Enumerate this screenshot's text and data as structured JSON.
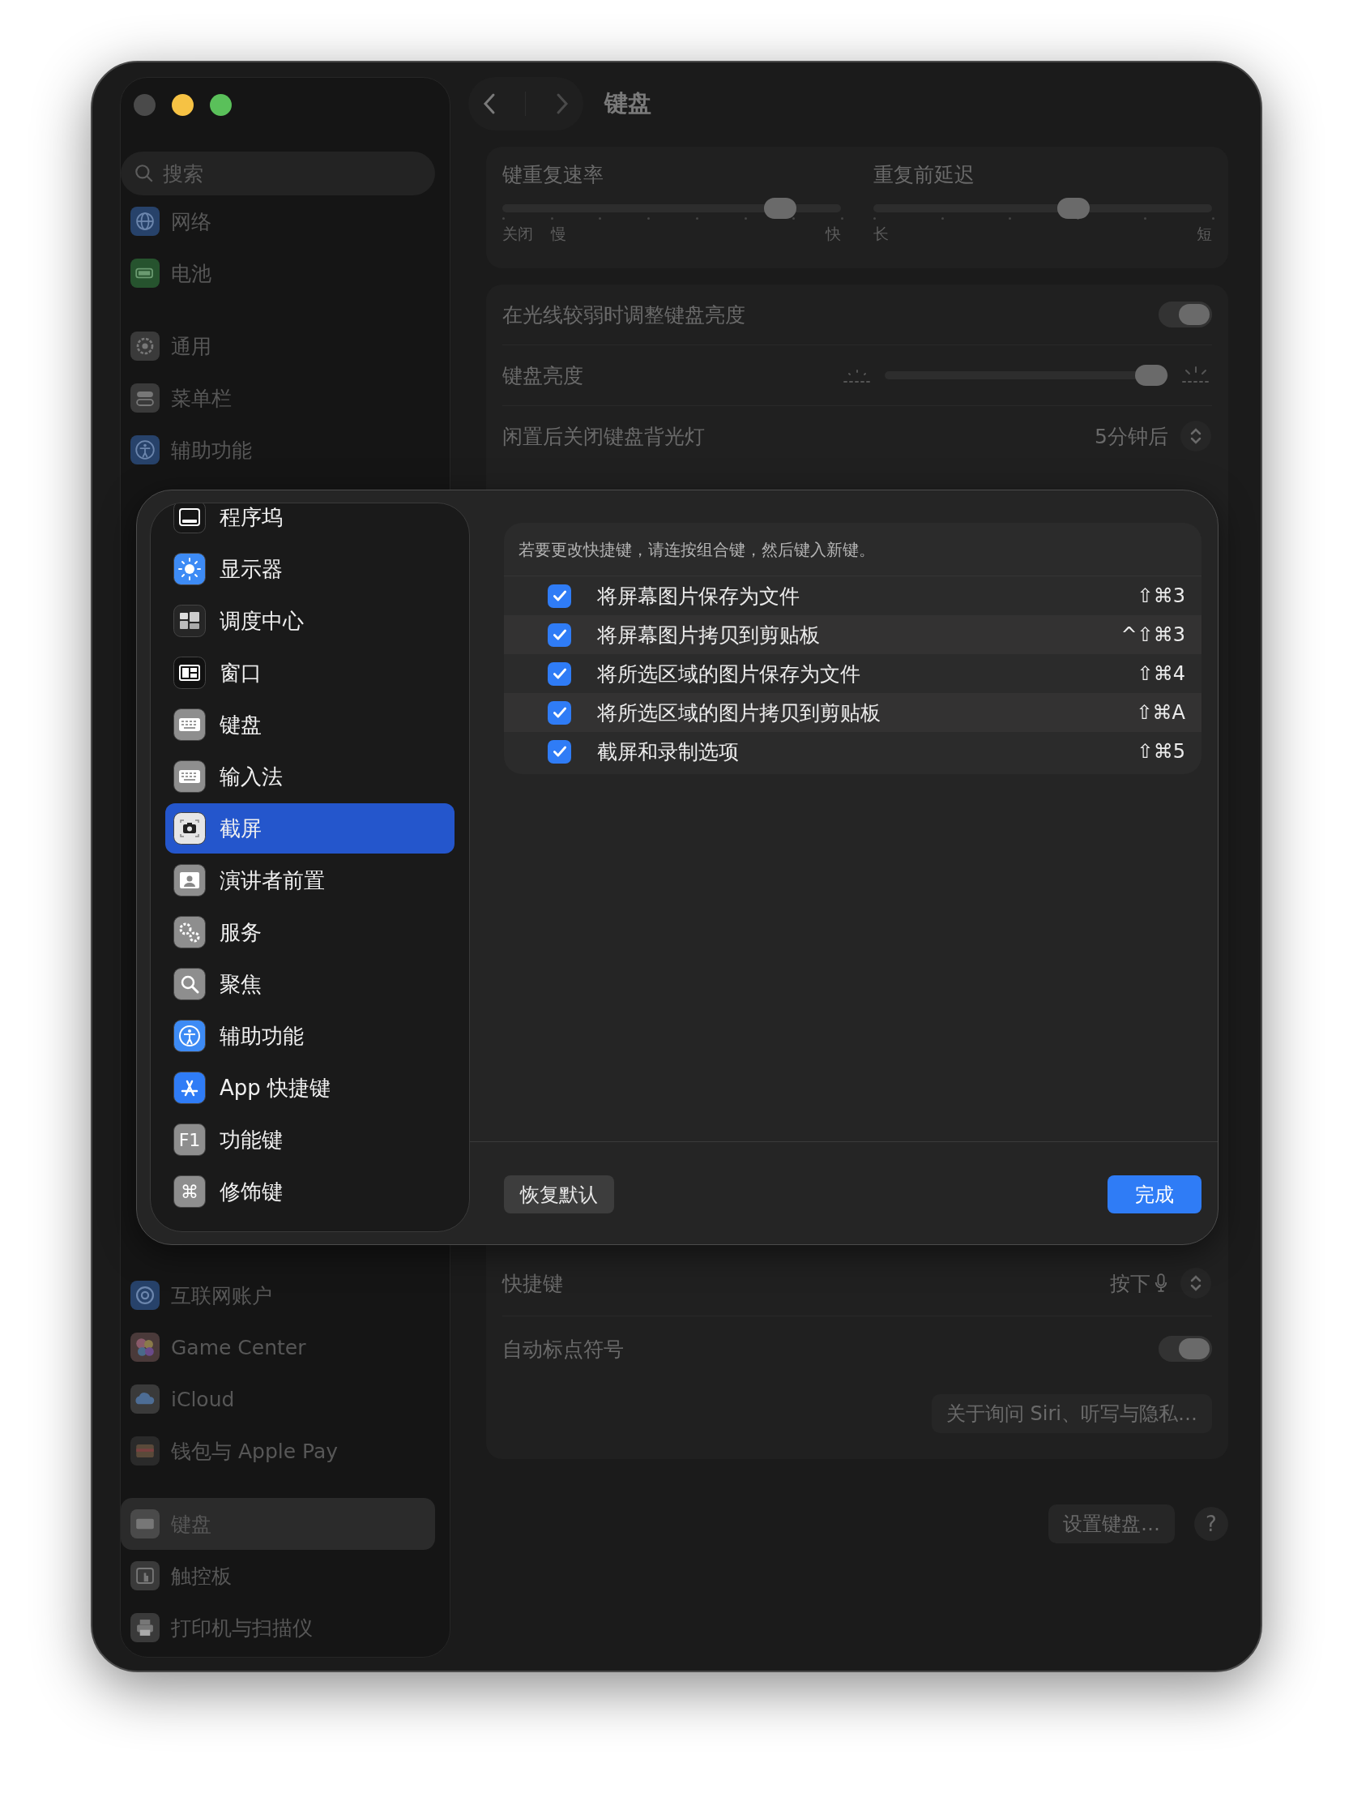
{
  "window": {
    "title": "键盘"
  },
  "sidebar": {
    "search": {
      "placeholder": "搜索"
    },
    "groups_top": [
      [
        {
          "label": "网络",
          "selected": false
        },
        {
          "label": "电池",
          "selected": false
        }
      ],
      [
        {
          "label": "通用",
          "selected": false
        },
        {
          "label": "菜单栏",
          "selected": false
        },
        {
          "label": "辅助功能",
          "selected": false
        }
      ]
    ],
    "groups_bottom": [
      [
        {
          "label": "互联网账户",
          "selected": false
        },
        {
          "label": "Game Center",
          "selected": false
        },
        {
          "label": "iCloud",
          "selected": false
        },
        {
          "label": "钱包与 Apple Pay",
          "selected": false
        }
      ],
      [
        {
          "label": "键盘",
          "selected": true
        },
        {
          "label": "触控板",
          "selected": false
        },
        {
          "label": "打印机与扫描仪",
          "selected": false
        }
      ]
    ]
  },
  "repeat_sliders": [
    {
      "label": "键重复速率",
      "level": 0.82,
      "left_labels": [
        "关闭",
        "慢"
      ],
      "right_label": "快"
    },
    {
      "label": "重复前延迟",
      "level": 0.59,
      "left_labels": [
        "长"
      ],
      "right_label": "短"
    }
  ],
  "backlight_rows": [
    {
      "kind": "toggle",
      "label": "在光线较弱时调整键盘亮度",
      "on": true
    },
    {
      "kind": "slider",
      "label": "键盘亮度",
      "level": 0.94
    },
    {
      "kind": "stepper",
      "label": "闲置后关闭键盘背光灯",
      "value": "5分钟后"
    }
  ],
  "dictation_rows": [
    {
      "kind": "stepper",
      "label": "快捷键",
      "value": "按下",
      "mic": true
    },
    {
      "kind": "toggle",
      "label": "自动标点符号",
      "on": true
    },
    {
      "kind": "button",
      "label": "关于询问 Siri、听写与隐私…"
    }
  ],
  "footer": {
    "button": "设置键盘…",
    "help": "?"
  },
  "dialog": {
    "categories": [
      {
        "label": "程序坞",
        "selected": false
      },
      {
        "label": "显示器",
        "selected": false
      },
      {
        "label": "调度中心",
        "selected": false
      },
      {
        "label": "窗口",
        "selected": false
      },
      {
        "label": "键盘",
        "selected": false
      },
      {
        "label": "输入法",
        "selected": false
      },
      {
        "label": "截屏",
        "selected": true
      },
      {
        "label": "演讲者前置",
        "selected": false
      },
      {
        "label": "服务",
        "selected": false
      },
      {
        "label": "聚焦",
        "selected": false
      },
      {
        "label": "辅助功能",
        "selected": false
      },
      {
        "label": "App 快捷键",
        "selected": false
      },
      {
        "label": "功能键",
        "selected": false,
        "icon_text": "F1"
      },
      {
        "label": "修饰键",
        "selected": false,
        "icon_text": "⌘"
      }
    ],
    "hint": "若要更改快捷键，请连按组合键，然后键入新键。",
    "shortcuts": [
      {
        "label": "将屏幕图片保存为文件",
        "checked": true,
        "keys": "⇧⌘3"
      },
      {
        "label": "将屏幕图片拷贝到剪贴板",
        "checked": true,
        "keys": "^⇧⌘3"
      },
      {
        "label": "将所选区域的图片保存为文件",
        "checked": true,
        "keys": "⇧⌘4"
      },
      {
        "label": "将所选区域的图片拷贝到剪贴板",
        "checked": true,
        "keys": "⇧⌘A"
      },
      {
        "label": "截屏和录制选项",
        "checked": true,
        "keys": "⇧⌘5"
      }
    ],
    "buttons": [
      {
        "label": "恢复默认",
        "kind": "secondary"
      },
      {
        "label": "完成",
        "kind": "primary"
      }
    ]
  }
}
